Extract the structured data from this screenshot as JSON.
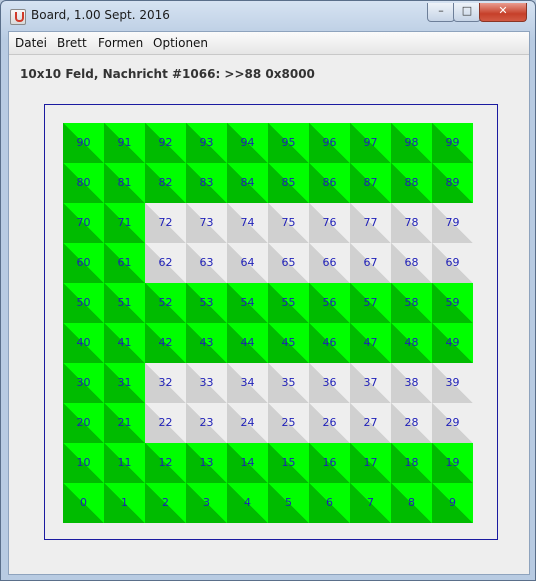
{
  "window": {
    "title": "Board, 1.00 Sept. 2016",
    "buttons": {
      "minimize": "–",
      "maximize": "□",
      "close": "✕"
    }
  },
  "menu": [
    "Datei",
    "Brett",
    "Formen",
    "Optionen"
  ],
  "status": "10x10 Feld, Nachricht #1066: >>88 0x8000",
  "board": {
    "cols": 10,
    "rows": 10,
    "colors": {
      "green_light": "#00ff00",
      "green_dark": "#00bb00",
      "gray_light": "#eeeeee",
      "gray_dark": "#d0d0d0",
      "number": "#1f1fb8"
    },
    "gray_cells": [
      22,
      23,
      24,
      25,
      26,
      27,
      28,
      29,
      32,
      33,
      34,
      35,
      36,
      37,
      38,
      39,
      62,
      63,
      64,
      65,
      66,
      67,
      68,
      69,
      72,
      73,
      74,
      75,
      76,
      77,
      78,
      79
    ]
  }
}
